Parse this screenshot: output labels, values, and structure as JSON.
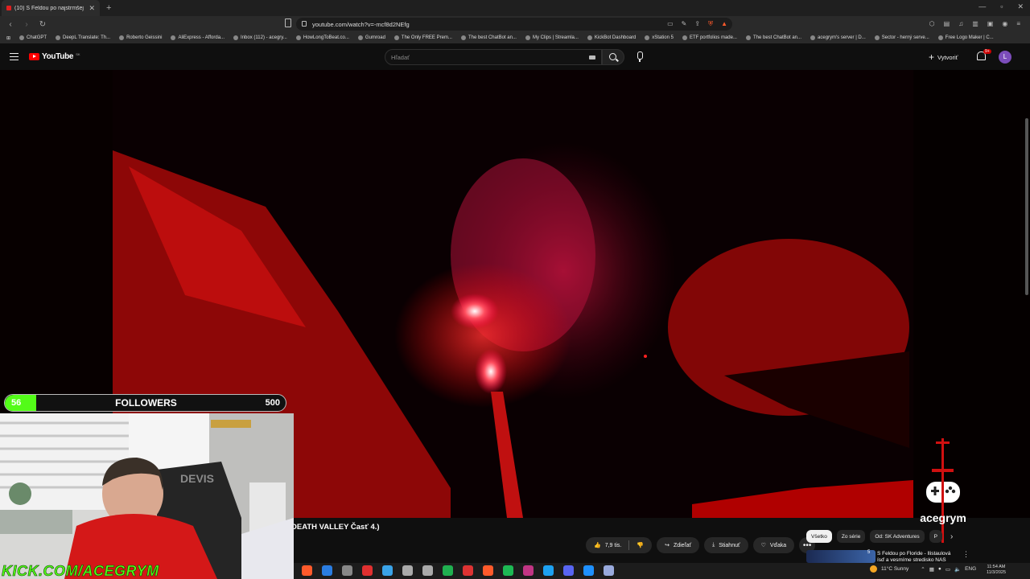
{
  "browser": {
    "tab_title": "(10) S Feldou po najstrmšej c",
    "new_tab_symbol": "+",
    "url": "youtube.com/watch?v=-mcf8d2NEfg",
    "bookmarks": [
      "ChatGPT",
      "DeepL Translate: Th...",
      "Roberto Geissini",
      "AliExpress - Afforda...",
      "Inbox (112) - acegry...",
      "HowLongToBeat.co...",
      "Gumroad",
      "The Only FREE Prem...",
      "The best ChatBot an...",
      "My Clips | Streamla...",
      "KickBot Dashboard",
      "xStation 5",
      "ETF portfolios made...",
      "The best ChatBot an...",
      "acegrym's server | D...",
      "Sector - herný serve...",
      "Free Logo Maker | C..."
    ]
  },
  "youtube": {
    "logo_text": "YouTube",
    "country_code": "SK",
    "search_placeholder": "Hľadať",
    "create_label": "Vytvoriť",
    "notifications_badge": "9+",
    "avatar_letter": "L",
    "video_title": "DEATH VALLEY Časť 4.)",
    "likes": "7,9 tis.",
    "share_label": "Zdieľať",
    "download_label": "Stiahnuť",
    "thanks_label": "Vďaka",
    "more_symbol": "•••",
    "chips": [
      "Všetko",
      "Zo série",
      "Od: SK Adventures",
      "P"
    ],
    "recommendation": {
      "title": "S Feldou po Floride - Ilistaulová ísď a vesmíme stredisko NAS",
      "duration": "5"
    }
  },
  "stream_overlay": {
    "followers_current": "56",
    "followers_label": "FOLLOWERS",
    "followers_goal": "500",
    "followers_progress": 0.112,
    "kick_url": "KICK.COM/ACEGRYM",
    "watermark": "acegrym",
    "chair_brand": "DEVIS"
  },
  "taskbar": {
    "weather": "11°C  Sunny",
    "lang": "ENG",
    "time": "11:54 AM",
    "date": "11/3/2025"
  },
  "colors": {
    "yt_red": "#ff0000",
    "kick_green": "#53fc18",
    "background": "#0f0f0f"
  }
}
